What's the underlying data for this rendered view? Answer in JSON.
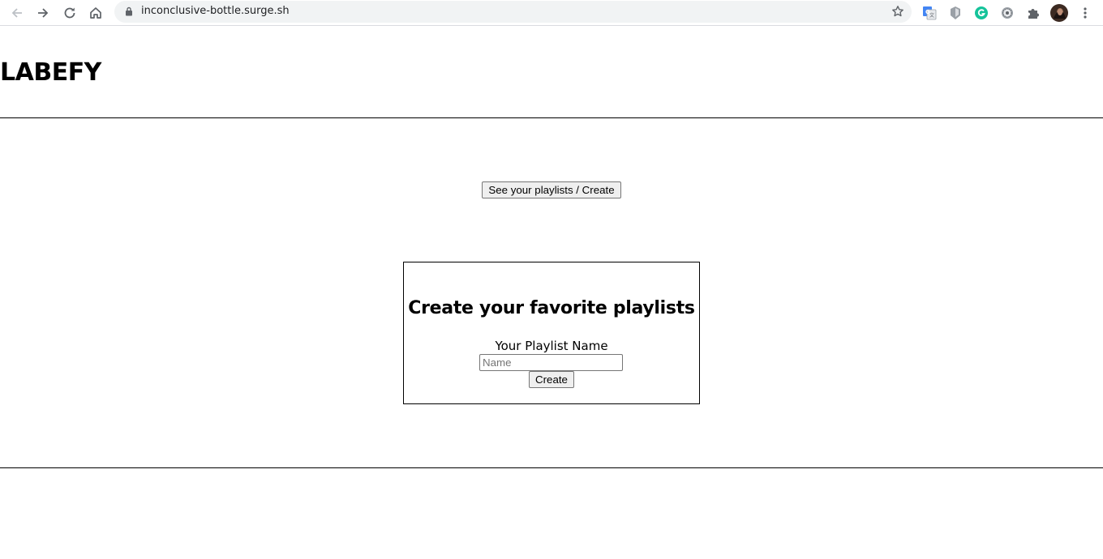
{
  "browser": {
    "url": "inconclusive-bottle.surge.sh"
  },
  "header": {
    "title": "LABEFY"
  },
  "main": {
    "see_playlists_button": "See your playlists / Create",
    "create_card": {
      "title": "Create your favorite playlists",
      "name_label": "Your Playlist Name",
      "name_placeholder": "Name",
      "name_value": "",
      "create_button": "Create"
    }
  },
  "colors": {
    "omnibox_bg": "#f1f3f4",
    "rule": "#000000",
    "button_bg": "#efefef",
    "grammarly_green": "#15c39a",
    "translate_blue": "#4285f4"
  }
}
